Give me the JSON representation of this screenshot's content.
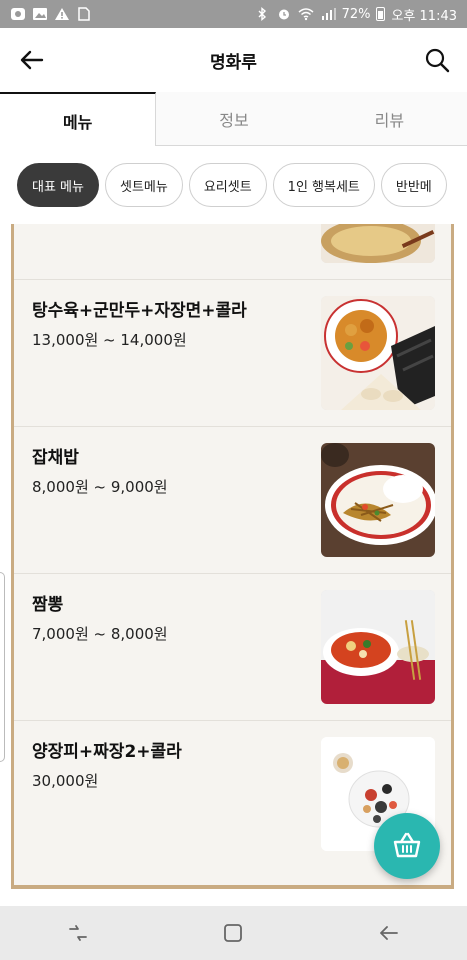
{
  "status_bar": {
    "battery": "72%",
    "time": "오후 11:43"
  },
  "app_bar": {
    "title": "명화루"
  },
  "tabs": [
    {
      "label": "메뉴",
      "active": true
    },
    {
      "label": "정보",
      "active": false
    },
    {
      "label": "리뷰",
      "active": false
    }
  ],
  "chips": [
    {
      "label": "대표 메뉴",
      "active": true
    },
    {
      "label": "셋트메뉴",
      "active": false
    },
    {
      "label": "요리셋트",
      "active": false
    },
    {
      "label": "1인 행복세트",
      "active": false
    },
    {
      "label": "반반메",
      "active": false
    }
  ],
  "menu_items": [
    {
      "name": "탕수육+군만두+자장면+콜라",
      "price": "13,000원 ~ 14,000원",
      "image": "tangsuyuk-set-photo"
    },
    {
      "name": "잡채밥",
      "price": "8,000원 ~ 9,000원",
      "image": "japchae-rice-photo"
    },
    {
      "name": "짬뽕",
      "price": "7,000원 ~ 8,000원",
      "image": "jjamppong-photo"
    },
    {
      "name": "양장피+짜장2+콜라",
      "price": "30,000원",
      "image": "yangjangpi-set-photo"
    }
  ],
  "colors": {
    "accent": "#2ab7b0",
    "chip_active": "#3a3a3a",
    "board_border": "#c9ab82",
    "status_bar": "#9a9a9a"
  }
}
